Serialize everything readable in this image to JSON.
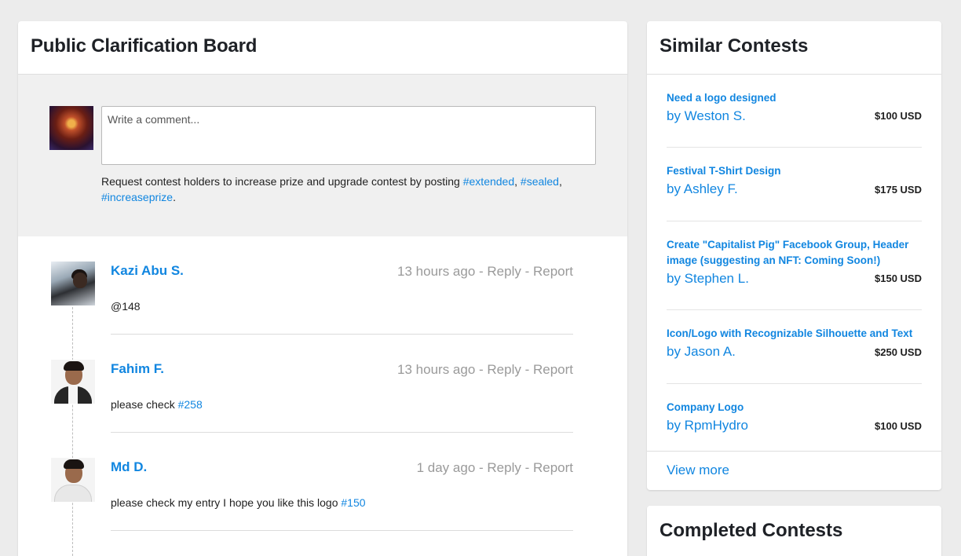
{
  "board": {
    "title": "Public Clarification Board",
    "compose": {
      "placeholder": "Write a comment...",
      "hint_text": "Request contest holders to increase prize and upgrade contest by posting ",
      "tags": [
        "#extended",
        "#sealed",
        "#increaseprize"
      ]
    },
    "comments": [
      {
        "name": "Kazi Abu S.",
        "time": "13 hours ago",
        "reply": "Reply",
        "report": "Report",
        "text": "@148",
        "link": ""
      },
      {
        "name": "Fahim F.",
        "time": "13 hours ago",
        "reply": "Reply",
        "report": "Report",
        "text": "please check ",
        "link": "#258"
      },
      {
        "name": "Md D.",
        "time": "1 day ago",
        "reply": "Reply",
        "report": "Report",
        "text": "please check my entry I hope you like this logo ",
        "link": "#150"
      }
    ]
  },
  "similar": {
    "title": "Similar Contests",
    "contests": [
      {
        "title": "Need a logo designed",
        "owner": "by Weston S.",
        "prize": "$100 USD"
      },
      {
        "title": "Festival T-Shirt Design",
        "owner": "by Ashley F.",
        "prize": "$175 USD"
      },
      {
        "title": "Create \"Capitalist Pig\" Facebook Group, Header image (suggesting an NFT: Coming Soon!)",
        "owner": "by Stephen L.",
        "prize": "$150 USD"
      },
      {
        "title": "Icon/Logo with Recognizable Silhouette and Text",
        "owner": "by Jason A.",
        "prize": "$250 USD"
      },
      {
        "title": "Company Logo",
        "owner": "by RpmHydro",
        "prize": "$100 USD"
      }
    ],
    "view_more": "View more"
  },
  "completed": {
    "title": "Completed Contests"
  }
}
